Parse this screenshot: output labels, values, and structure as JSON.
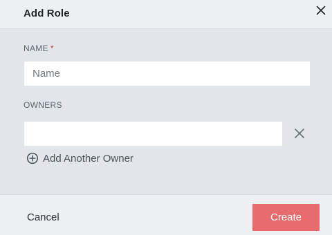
{
  "dialog": {
    "title": "Add Role"
  },
  "form": {
    "name_label": "NAME",
    "required_marker": "*",
    "name_placeholder": "Name",
    "name_value": "",
    "owners_label": "OWNERS",
    "owner_value": "",
    "add_owner_label": "Add Another Owner"
  },
  "footer": {
    "cancel_label": "Cancel",
    "create_label": "Create"
  },
  "colors": {
    "accent": "#e86b6e",
    "required": "#c0392b",
    "background": "#e2e6ea",
    "header_footer": "#eef0f3"
  },
  "icons": [
    "close-icon",
    "remove-owner-icon",
    "add-circle-icon"
  ]
}
